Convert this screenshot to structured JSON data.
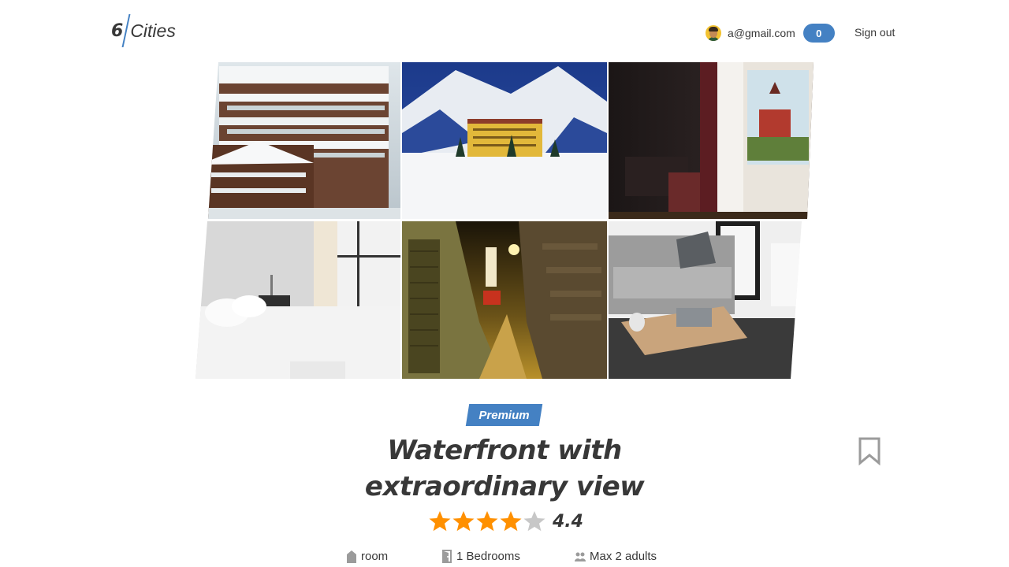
{
  "header": {
    "logo_number": "6",
    "logo_text": "Cities",
    "user_email": "a@gmail.com",
    "favorites_count": "0",
    "sign_out_label": "Sign out"
  },
  "gallery": {
    "images": [
      {
        "name": "snowy-chalet-hotel-photo"
      },
      {
        "name": "mountain-lake-hotel-photo"
      },
      {
        "name": "hotel-room-window-view-photo"
      },
      {
        "name": "white-bedroom-photo"
      },
      {
        "name": "hotel-alley-night-photo"
      },
      {
        "name": "living-room-sofa-photo"
      }
    ]
  },
  "offer": {
    "premium_label": "Premium",
    "title_line1": "Waterfront with",
    "title_line2": "extraordinary view",
    "rating_value": "4.4",
    "rating_fraction": 0.8,
    "stars_filled": 4,
    "stars_total": 5,
    "features": {
      "type": "room",
      "bedrooms": "1 Bedrooms",
      "adults": "Max 2 adults"
    }
  },
  "colors": {
    "accent": "#4481c3",
    "star_filled": "#ff9000",
    "star_empty": "#c7c7c7",
    "text": "#383838",
    "icon_gray": "#9b9b9b"
  },
  "icons": {
    "bookmark": "bookmark-icon",
    "star": "star-icon",
    "room": "house-icon",
    "bedrooms": "door-icon",
    "adults": "people-icon"
  }
}
